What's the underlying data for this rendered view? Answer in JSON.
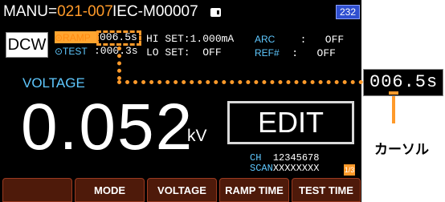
{
  "header": {
    "manu_label": "MANU",
    "manu_eq": "=",
    "manu_value": "021-007",
    "file_name": "IEC-M00007",
    "badge": "232"
  },
  "mode_box": {
    "label": "DCW"
  },
  "params": {
    "ramp_label": "⊙RAMP",
    "ramp_value": "006.5s",
    "test_label": "⊙TEST",
    "test_value": ":000.3s",
    "hi_set_label": "HI SET:",
    "hi_set_value": "1.000mA",
    "lo_set_label": "LO SET:",
    "lo_set_value": "OFF",
    "arc_label": "ARC",
    "arc_sep": ":",
    "arc_value": "OFF",
    "ref_label": "REF#",
    "ref_sep": ":",
    "ref_value": "OFF"
  },
  "main": {
    "voltage_label": "VOLTAGE",
    "value": "0.052",
    "unit": "kV",
    "edit_label": "EDIT"
  },
  "channels": {
    "ch_label": "CH",
    "ch_numbers": "12345678",
    "scan_label": "SCAN",
    "scan_values": "XXXXXXXX",
    "page": "1/3"
  },
  "softkeys": [
    "",
    "MODE",
    "VOLTAGE",
    "RAMP TIME",
    "TEST TIME"
  ],
  "callout": {
    "value": "006.5s",
    "cursor_label": "カーソル"
  },
  "colors": {
    "accent": "#ff9a2a",
    "label_blue": "#5fc8ff",
    "softkey_bg": "#4e1a0a",
    "badge_blue": "#2f4fd0"
  }
}
